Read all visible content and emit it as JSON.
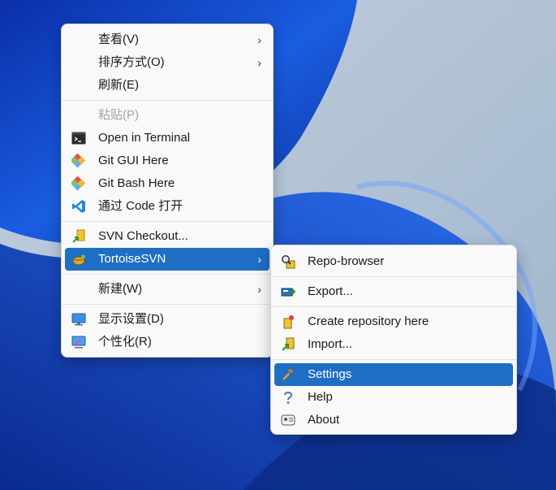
{
  "context_menu": {
    "items": [
      {
        "label": "查看(V)",
        "submenu": true
      },
      {
        "label": "排序方式(O)",
        "submenu": true
      },
      {
        "label": "刷新(E)"
      },
      {
        "label": "粘贴(P)",
        "disabled": true
      },
      {
        "label": "Open in Terminal",
        "icon": "terminal-icon"
      },
      {
        "label": "Git GUI Here",
        "icon": "git-icon"
      },
      {
        "label": "Git Bash Here",
        "icon": "git-icon"
      },
      {
        "label": "通过 Code 打开",
        "icon": "vscode-icon"
      },
      {
        "label": "SVN Checkout...",
        "icon": "svn-checkout-icon"
      },
      {
        "label": "TortoiseSVN",
        "icon": "tortoisesvn-icon",
        "submenu": true,
        "highlighted": true
      },
      {
        "label": "新建(W)",
        "submenu": true
      },
      {
        "label": "显示设置(D)",
        "icon": "display-icon"
      },
      {
        "label": "个性化(R)",
        "icon": "personalize-icon"
      }
    ]
  },
  "tortoisesvn_submenu": {
    "items": [
      {
        "label": "Repo-browser",
        "icon": "repo-browser-icon"
      },
      {
        "label": "Export...",
        "icon": "export-icon"
      },
      {
        "label": "Create repository here",
        "icon": "create-repository-icon"
      },
      {
        "label": "Import...",
        "icon": "import-icon"
      },
      {
        "label": "Settings",
        "icon": "settings-icon",
        "highlighted": true
      },
      {
        "label": "Help",
        "icon": "help-icon"
      },
      {
        "label": "About",
        "icon": "about-icon"
      }
    ]
  },
  "chevron_glyph": "›",
  "colors": {
    "highlight": "#1e6fc4",
    "menu_bg": "#f9f9f9",
    "disabled_text": "#a4a4a4"
  }
}
